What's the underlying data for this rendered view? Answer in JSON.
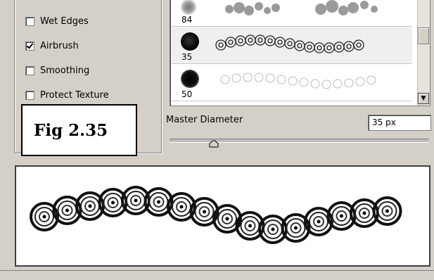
{
  "options": [
    {
      "label": "Wet Edges",
      "checked": false
    },
    {
      "label": "Airbrush",
      "checked": true
    },
    {
      "label": "Smoothing",
      "checked": false
    },
    {
      "label": "Protect Texture",
      "checked": false
    }
  ],
  "figure_caption": "Fig 2.35",
  "brushes": [
    {
      "size": "84",
      "style": "spatter"
    },
    {
      "size": "35",
      "style": "swirl-rings",
      "selected": true
    },
    {
      "size": "50",
      "style": "outline-swirl"
    }
  ],
  "master_diameter": {
    "label": "Master Diameter",
    "value": "35 px",
    "slider_fraction": 0.17
  },
  "colors": {
    "panel": "#d4d0c8",
    "border": "#808080"
  }
}
